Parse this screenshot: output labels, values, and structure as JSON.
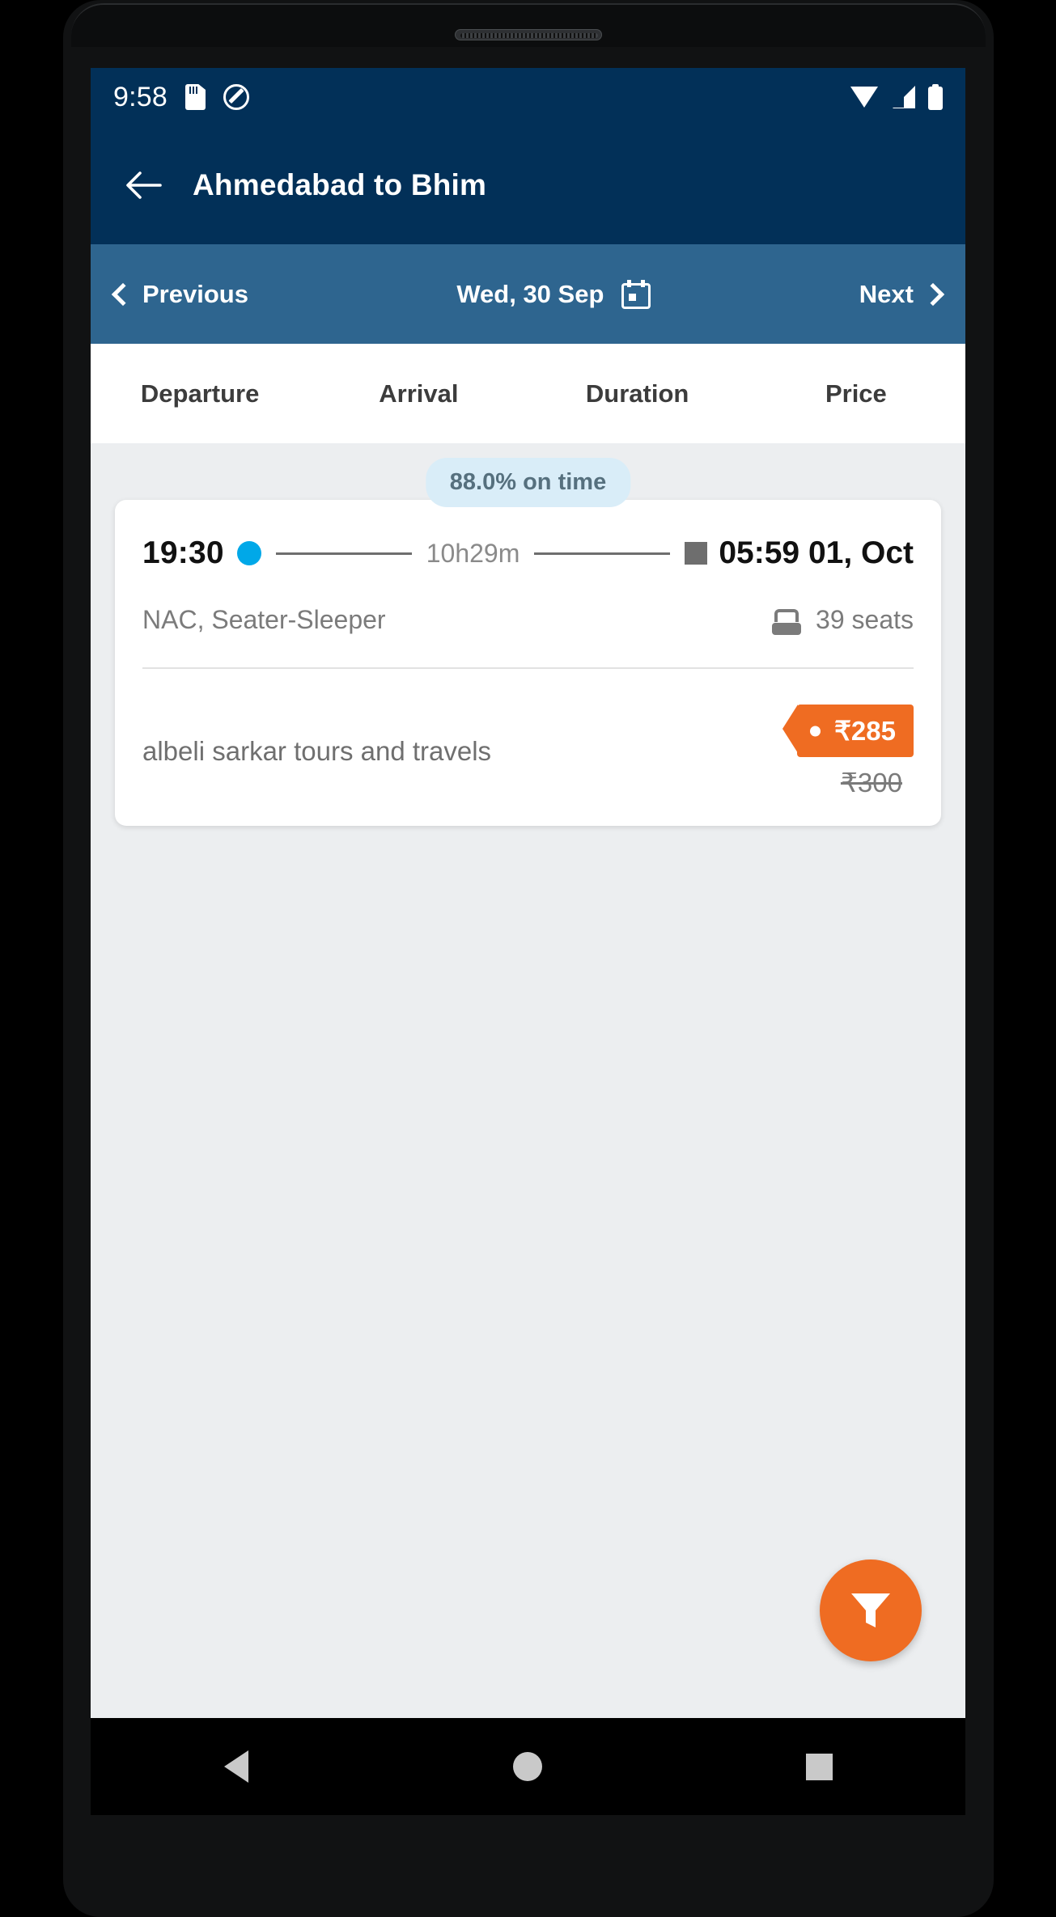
{
  "status_bar": {
    "clock": "9:58",
    "left_icons": [
      "sd-card-icon",
      "do-not-disturb-icon"
    ],
    "right_icons": [
      "wifi-icon",
      "cellular-signal-icon",
      "battery-icon"
    ]
  },
  "app_bar": {
    "back_icon": "back-arrow-icon",
    "title": "Ahmedabad to Bhim",
    "background_color": "#023058"
  },
  "date_nav": {
    "previous_label": "Previous",
    "date_label": "Wed, 30 Sep",
    "next_label": "Next",
    "calendar_icon": "calendar-icon",
    "background_color": "#2e658f"
  },
  "sort_bar": {
    "tabs": [
      {
        "label": "Departure"
      },
      {
        "label": "Arrival"
      },
      {
        "label": "Duration"
      },
      {
        "label": "Price"
      }
    ]
  },
  "results": {
    "ontime_badge": "88.0% on time",
    "bus": {
      "departure_time": "19:30",
      "duration": "10h29m",
      "arrival_time": "05:59 01, Oct",
      "bus_type": "NAC, Seater-Sleeper",
      "seats_available": "39 seats",
      "operator_name": "albeli sarkar tours and travels",
      "price": "₹285",
      "original_price": "₹300",
      "departure_dot_color": "#00a8e8",
      "arrival_marker_color": "#6e6e6e",
      "price_tag_color": "#ef6c22"
    }
  },
  "filter_fab": {
    "icon": "filter-funnel-icon",
    "color": "#ef6c22"
  },
  "nav_bar": {
    "back": "back-triangle-icon",
    "home": "home-circle-icon",
    "recents": "recents-square-icon"
  }
}
